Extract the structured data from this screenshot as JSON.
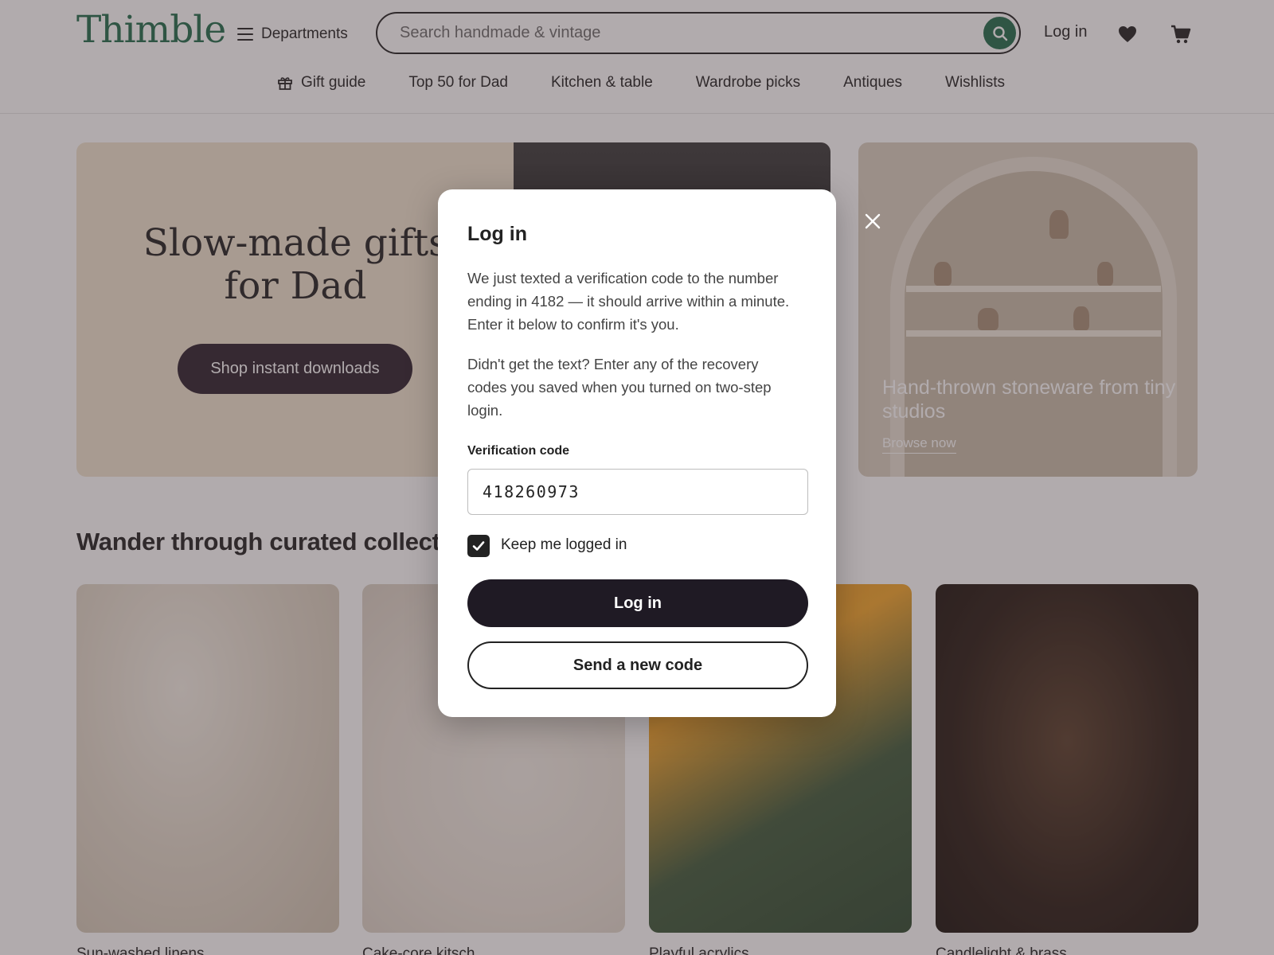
{
  "header": {
    "logo": "Thimble",
    "departments_label": "Departments",
    "search_placeholder": "Search handmade & vintage",
    "login_label": "Log in",
    "brand_color": "#1f6b4a"
  },
  "subnav": {
    "items": [
      "Gift guide",
      "Top 50 for Dad",
      "Kitchen & table",
      "Wardrobe picks",
      "Antiques",
      "Wishlists"
    ]
  },
  "hero": {
    "title": "Slow-made gifts for Dad",
    "button_label": "Shop instant downloads",
    "side_caption": "Hand-thrown stoneware from tiny studios",
    "side_link": "Browse now"
  },
  "collections": {
    "title": "Wander through curated collections",
    "cards": [
      {
        "label": "Sun-washed linens"
      },
      {
        "label": "Cake-core kitsch"
      },
      {
        "label": "Playful acrylics"
      },
      {
        "label": "Candlelight & brass"
      }
    ]
  },
  "modal": {
    "title": "Log in",
    "message_primary": "We just texted a verification code to the number ending in 4182 — it should arrive within a minute. Enter it below to confirm it's you.",
    "message_secondary": "Didn't get the text? Enter any of the recovery codes you saved when you turned on two-step login.",
    "field_label": "Verification code",
    "field_value": "418260973",
    "keep_logged_in_label": "Keep me logged in",
    "keep_logged_in_checked": true,
    "primary_button": "Log in",
    "secondary_button": "Send a new code"
  },
  "icons": {
    "menu": "hamburger-icon",
    "search": "search-icon",
    "favorites": "heart-icon",
    "cart": "cart-icon",
    "gift": "gift-icon",
    "close": "close-icon",
    "check": "check-icon"
  }
}
